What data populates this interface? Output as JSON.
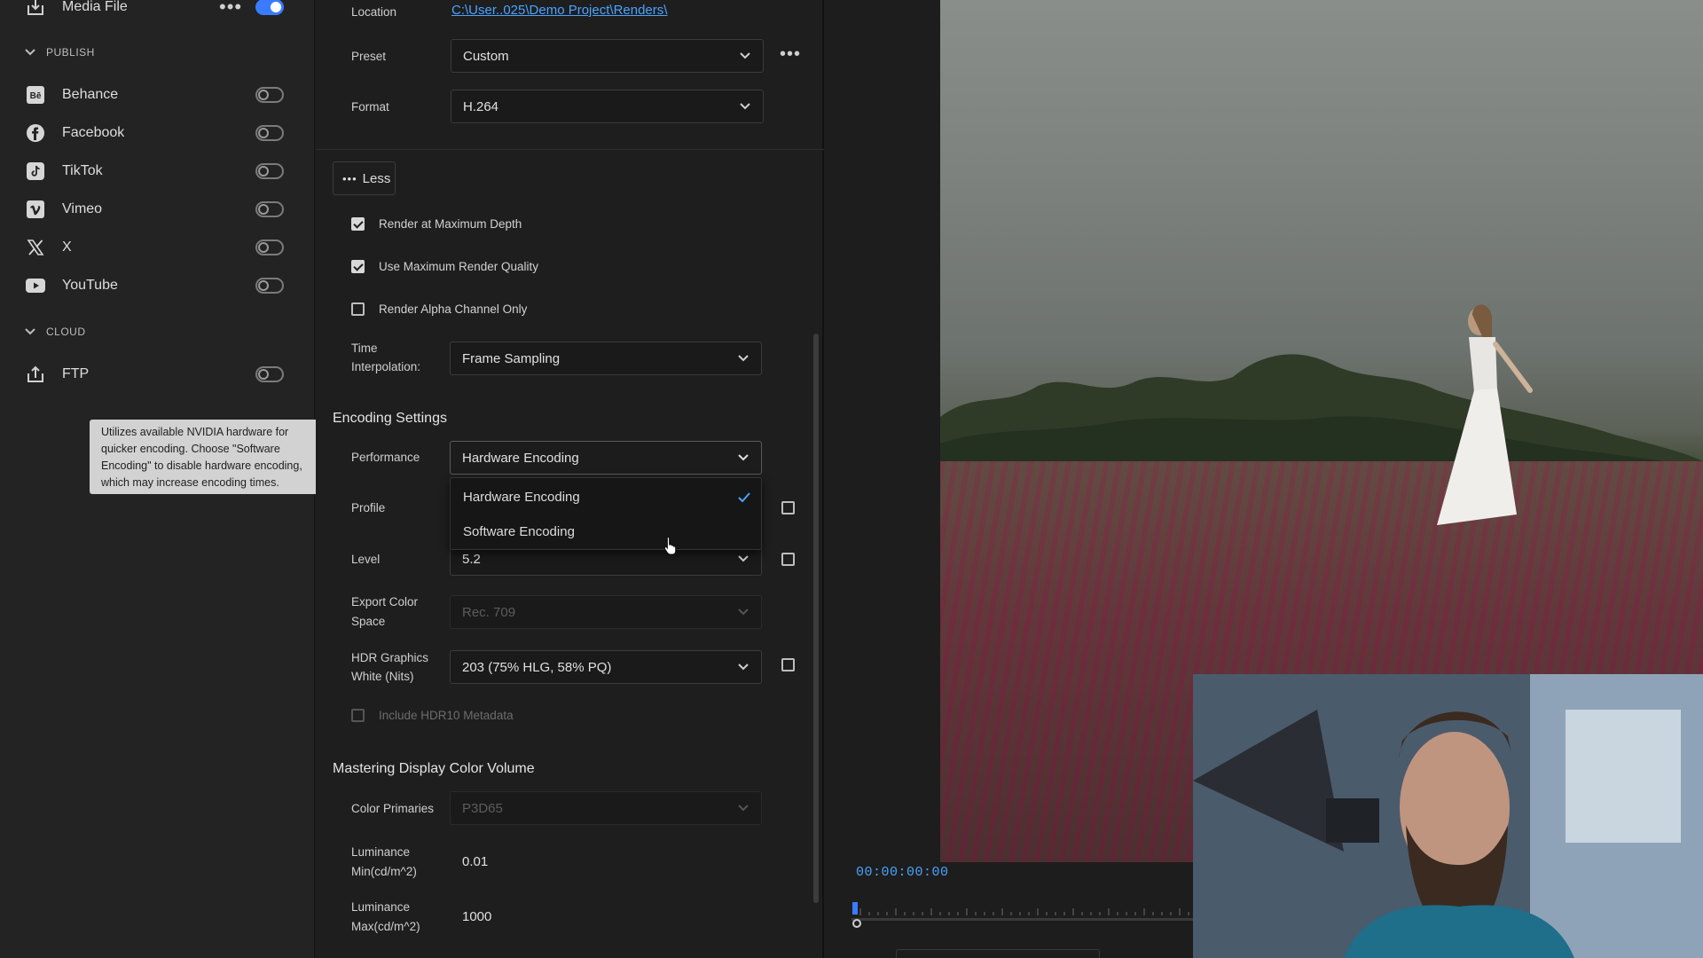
{
  "sidebar": {
    "media_file": {
      "label": "Media File",
      "enabled": true
    },
    "publish_header": "PUBLISH",
    "publish_items": [
      {
        "label": "Behance",
        "icon": "behance-icon",
        "enabled": false
      },
      {
        "label": "Facebook",
        "icon": "facebook-icon",
        "enabled": false
      },
      {
        "label": "TikTok",
        "icon": "tiktok-icon",
        "enabled": false
      },
      {
        "label": "Vimeo",
        "icon": "vimeo-icon",
        "enabled": false
      },
      {
        "label": "X",
        "icon": "x-icon",
        "enabled": false
      },
      {
        "label": "YouTube",
        "icon": "youtube-icon",
        "enabled": false
      }
    ],
    "cloud_header": "CLOUD",
    "cloud_items": [
      {
        "label": "FTP",
        "icon": "upload-icon",
        "enabled": false
      }
    ],
    "tooltip": "Utilizes available NVIDIA hardware for quicker encoding. Choose \"Software Encoding\" to disable hardware encoding, which may increase encoding times."
  },
  "settings": {
    "location_label": "Location",
    "location_value": "C:\\User..025\\Demo Project\\Renders\\",
    "preset_label": "Preset",
    "preset_value": "Custom",
    "format_label": "Format",
    "format_value": "H.264",
    "less_button": "Less",
    "checkboxes": {
      "max_depth": {
        "label": "Render at Maximum Depth",
        "checked": true
      },
      "max_quality": {
        "label": "Use Maximum Render Quality",
        "checked": true
      },
      "alpha_only": {
        "label": "Render Alpha Channel Only",
        "checked": false
      }
    },
    "time_interp_label_1": "Time",
    "time_interp_label_2": "Interpolation:",
    "time_interp_value": "Frame Sampling",
    "encoding_title": "Encoding Settings",
    "performance_label": "Performance",
    "performance_value": "Hardware Encoding",
    "performance_options": [
      "Hardware Encoding",
      "Software Encoding"
    ],
    "performance_selected": "Hardware Encoding",
    "profile_label": "Profile",
    "level_label": "Level",
    "level_value": "5.2",
    "export_cs_label_1": "Export Color",
    "export_cs_label_2": "Space",
    "export_cs_value": "Rec. 709",
    "hdr_label_1": "HDR Graphics",
    "hdr_label_2": "White (Nits)",
    "hdr_value": "203 (75% HLG, 58% PQ)",
    "hdr10_label": "Include HDR10 Metadata",
    "mastering_title": "Mastering Display Color Volume",
    "primaries_label": "Color Primaries",
    "primaries_value": "P3D65",
    "lum_min_label_1": "Luminance",
    "lum_min_label_2": "Min(cd/m^2)",
    "lum_min_value": "0.01",
    "lum_max_label_1": "Luminance",
    "lum_max_label_2": "Max(cd/m^2)",
    "lum_max_value": "1000"
  },
  "preview": {
    "timecode": "00:00:00:00"
  },
  "colors": {
    "accent": "#3a7cff",
    "timecode": "#4aa3ff"
  }
}
